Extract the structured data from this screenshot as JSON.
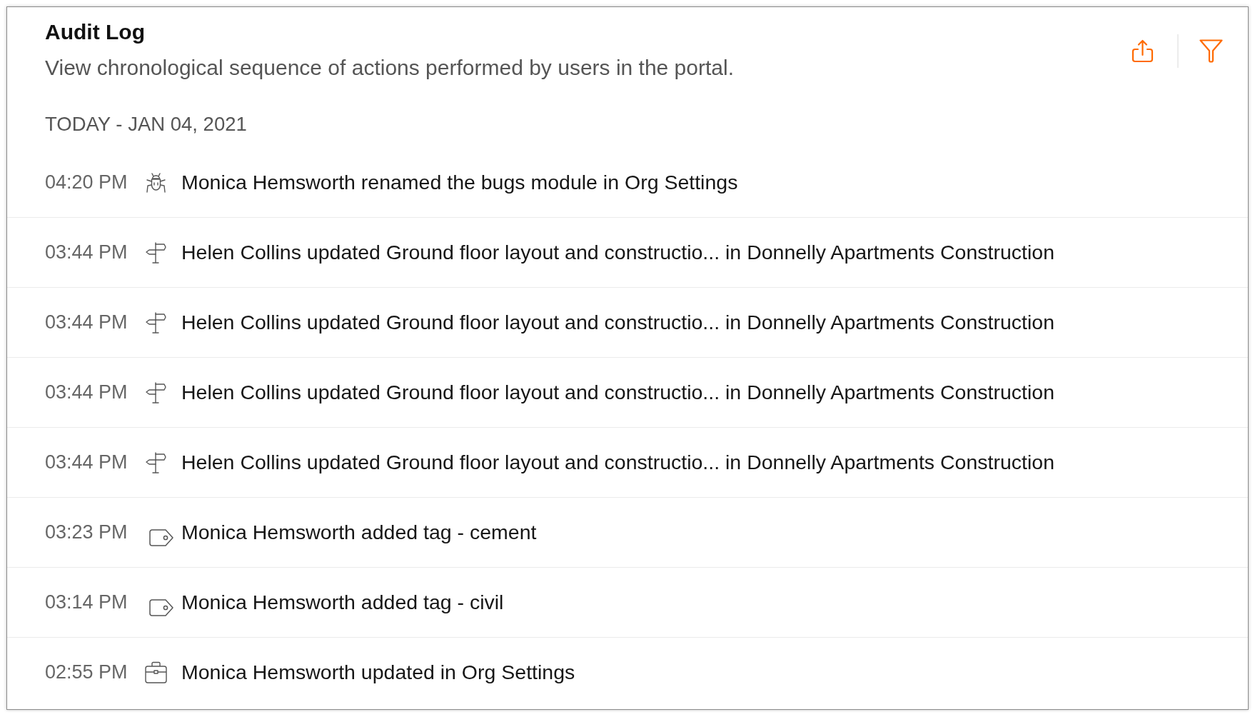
{
  "header": {
    "title": "Audit Log",
    "subtitle": "View chronological sequence of actions performed by users in the portal."
  },
  "sections": [
    {
      "label": "TODAY - JAN 04, 2021",
      "entries": [
        {
          "time": "04:20 PM",
          "kind": "bug",
          "text": "Monica Hemsworth renamed the bugs module in Org Settings"
        },
        {
          "time": "03:44 PM",
          "kind": "milestone",
          "text": "Helen Collins updated Ground floor layout and constructio... in Donnelly Apartments Construction"
        },
        {
          "time": "03:44 PM",
          "kind": "milestone",
          "text": "Helen Collins updated Ground floor layout and constructio... in Donnelly Apartments Construction"
        },
        {
          "time": "03:44 PM",
          "kind": "milestone",
          "text": "Helen Collins updated Ground floor layout and constructio... in Donnelly Apartments Construction"
        },
        {
          "time": "03:44 PM",
          "kind": "milestone",
          "text": "Helen Collins updated Ground floor layout and constructio... in Donnelly Apartments Construction"
        },
        {
          "time": "03:23 PM",
          "kind": "tag",
          "text": "Monica Hemsworth added tag - cement"
        },
        {
          "time": "03:14 PM",
          "kind": "tag",
          "text": "Monica Hemsworth added tag - civil"
        },
        {
          "time": "02:55 PM",
          "kind": "settings",
          "text": "Monica Hemsworth updated in Org Settings"
        }
      ]
    }
  ]
}
